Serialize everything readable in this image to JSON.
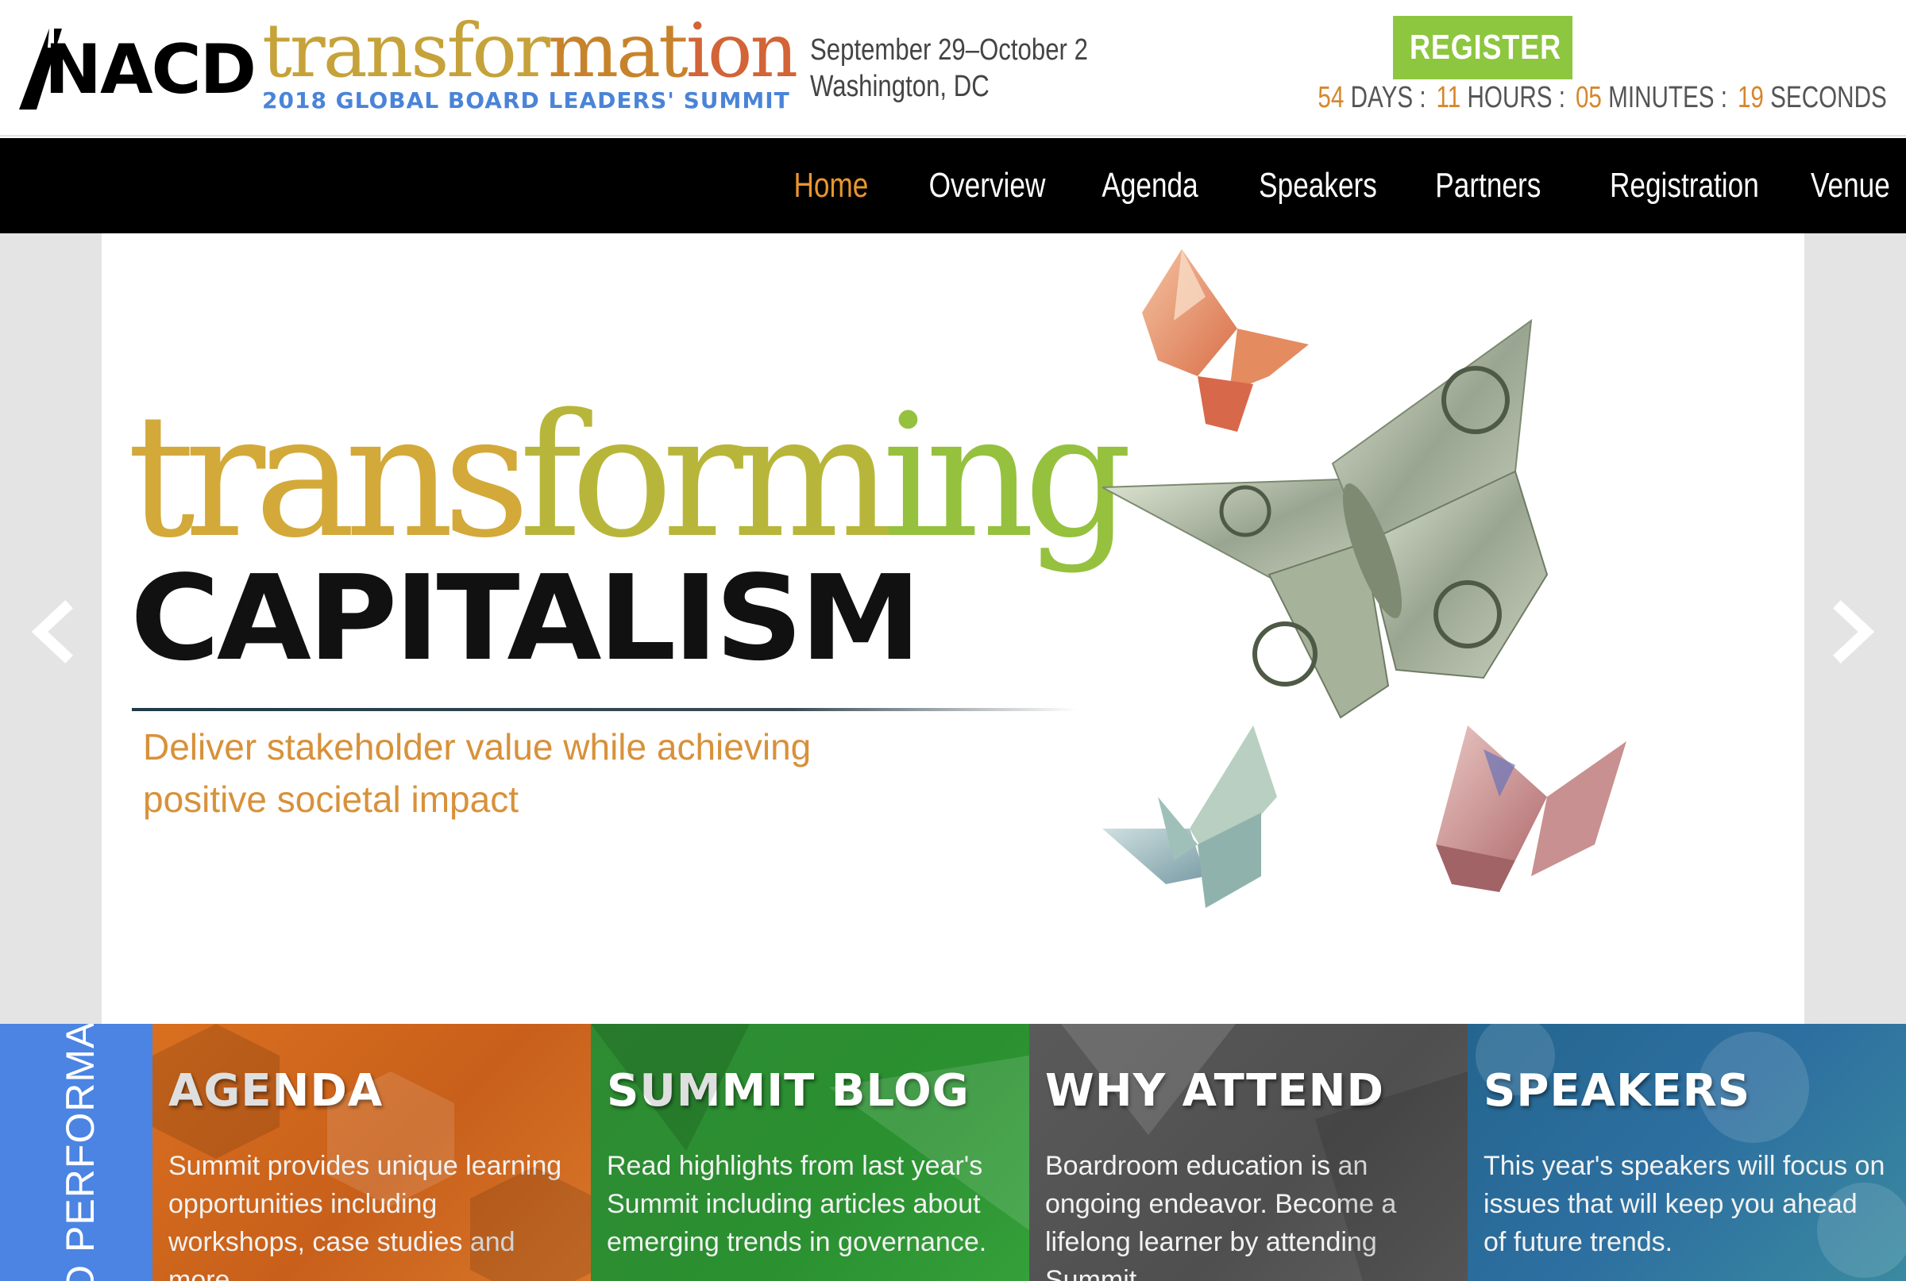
{
  "header": {
    "logo_text": "NACD",
    "event_title": [
      "transfor",
      "mat",
      "ion"
    ],
    "event_subtitle": "2018 GLOBAL BOARD LEADERS' SUMMIT",
    "dates": "September 29–October 2",
    "location": "Washington, DC",
    "register_label": "REGISTER",
    "countdown": {
      "days": "54",
      "days_label": "DAYS :",
      "hours": "11",
      "hours_label": "HOURS :",
      "minutes": "05",
      "minutes_label": "MINUTES :",
      "seconds": "19",
      "seconds_label": "SECONDS"
    }
  },
  "nav": {
    "items": [
      "Home",
      "Overview",
      "Agenda",
      "Speakers",
      "Partners",
      "Registration",
      "Venue"
    ],
    "active": "Home"
  },
  "hero": {
    "title_parts": [
      "trans",
      "form",
      "ing"
    ],
    "title_caps": "CAPITALISM",
    "tagline_line1": "Deliver stakeholder value while achieving",
    "tagline_line2": "positive societal impact"
  },
  "side_tab": {
    "label": "D PERFORMANCE"
  },
  "tiles": [
    {
      "title": "AGENDA",
      "text": "Summit provides unique learning opportunities including workshops, case studies and more."
    },
    {
      "title": "SUMMIT BLOG",
      "text": "Read highlights from last year's Summit including articles about emerging trends in governance."
    },
    {
      "title": "WHY ATTEND",
      "text": "Boardroom education is an ongoing endeavor. Become a lifelong learner by attending Summit."
    },
    {
      "title": "SPEAKERS",
      "text": "This year's speakers will focus on issues that will keep you ahead of future trends."
    }
  ],
  "colors": {
    "register": "#8dc63f",
    "nav_active": "#e8962f",
    "countdown_numbers": "#d6872c",
    "tile_agenda": "#d96f1f",
    "tile_blog": "#2e8b33",
    "tile_why": "#555555",
    "tile_speakers": "#2d6fa0",
    "side_tab": "#4b84e2"
  }
}
